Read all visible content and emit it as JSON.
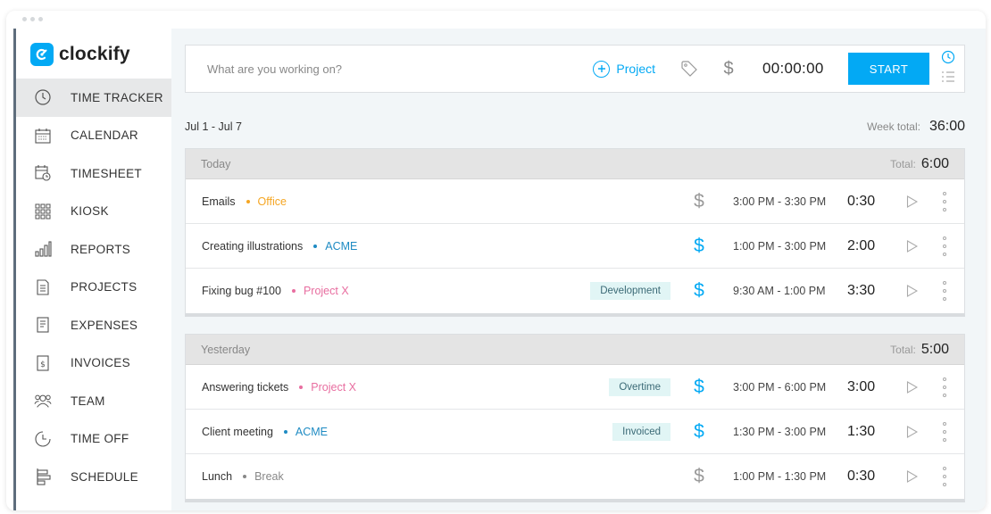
{
  "app": {
    "name": "clockify"
  },
  "colors": {
    "accent": "#03a9f4",
    "orange": "#f5a623",
    "blue": "#1e8bc3",
    "pink": "#e86ea0",
    "gray": "#888888"
  },
  "sidebar": {
    "items": [
      {
        "label": "TIME TRACKER",
        "icon": "clock-icon",
        "active": true
      },
      {
        "label": "CALENDAR",
        "icon": "calendar-icon"
      },
      {
        "label": "TIMESHEET",
        "icon": "timesheet-icon"
      },
      {
        "label": "KIOSK",
        "icon": "kiosk-grid-icon"
      },
      {
        "label": "REPORTS",
        "icon": "bar-chart-icon"
      },
      {
        "label": "PROJECTS",
        "icon": "document-icon"
      },
      {
        "label": "EXPENSES",
        "icon": "receipt-icon"
      },
      {
        "label": "INVOICES",
        "icon": "invoice-icon"
      },
      {
        "label": "TEAM",
        "icon": "team-icon"
      },
      {
        "label": "TIME OFF",
        "icon": "time-off-icon"
      },
      {
        "label": "SCHEDULE",
        "icon": "schedule-icon"
      }
    ]
  },
  "tracker": {
    "placeholder": "What are you working on?",
    "project_label": "Project",
    "timer": "00:00:00",
    "start_label": "START"
  },
  "week": {
    "range": "Jul 1 - Jul 7",
    "total_label": "Week total:",
    "total": "36:00"
  },
  "days": [
    {
      "label": "Today",
      "total_label": "Total:",
      "total": "6:00",
      "entries": [
        {
          "description": "Emails",
          "project": "Office",
          "project_color": "#f5a623",
          "tag": "",
          "billable": false,
          "range": "3:00 PM - 3:30 PM",
          "duration": "0:30"
        },
        {
          "description": "Creating illustrations",
          "project": "ACME",
          "project_color": "#1e8bc3",
          "tag": "",
          "billable": true,
          "range": "1:00 PM - 3:00 PM",
          "duration": "2:00"
        },
        {
          "description": "Fixing bug #100",
          "project": "Project X",
          "project_color": "#e86ea0",
          "tag": "Development",
          "billable": true,
          "range": "9:30 AM - 1:00 PM",
          "duration": "3:30"
        }
      ]
    },
    {
      "label": "Yesterday",
      "total_label": "Total:",
      "total": "5:00",
      "entries": [
        {
          "description": "Answering tickets",
          "project": "Project X",
          "project_color": "#e86ea0",
          "tag": "Overtime",
          "billable": true,
          "range": "3:00 PM - 6:00 PM",
          "duration": "3:00"
        },
        {
          "description": "Client meeting",
          "project": "ACME",
          "project_color": "#1e8bc3",
          "tag": "Invoiced",
          "billable": true,
          "range": "1:30 PM - 3:00 PM",
          "duration": "1:30"
        },
        {
          "description": "Lunch",
          "project": "Break",
          "project_color": "#888888",
          "tag": "",
          "billable": false,
          "range": "1:00 PM - 1:30 PM",
          "duration": "0:30"
        }
      ]
    }
  ]
}
